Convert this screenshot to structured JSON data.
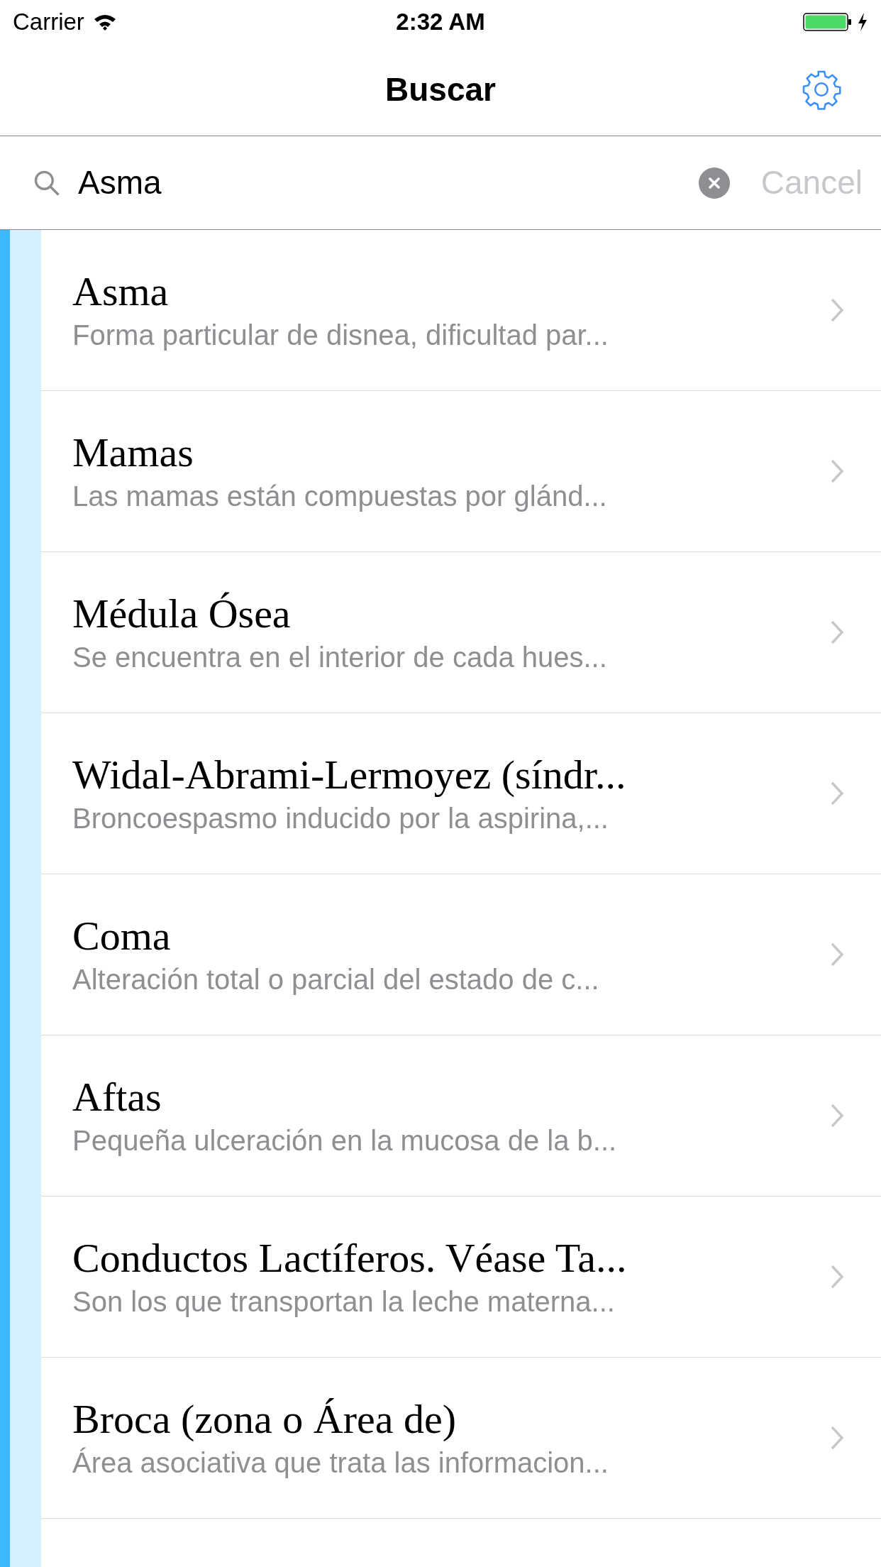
{
  "status_bar": {
    "carrier": "Carrier",
    "time": "2:32 AM"
  },
  "nav_bar": {
    "title": "Buscar"
  },
  "search": {
    "value": "Asma",
    "cancel": "Cancel"
  },
  "results": [
    {
      "title": "Asma",
      "subtitle": "Forma particular de disnea, dificultad par..."
    },
    {
      "title": "Mamas",
      "subtitle": "Las mamas están compuestas por glánd..."
    },
    {
      "title": "Médula Ósea",
      "subtitle": "Se encuentra en el interior de cada hues..."
    },
    {
      "title": "Widal-Abrami-Lermoyez (síndr...",
      "subtitle": "Broncoespasmo inducido por la aspirina,..."
    },
    {
      "title": "Coma",
      "subtitle": "Alteración total o parcial del estado de c..."
    },
    {
      "title": "Aftas",
      "subtitle": "Pequeña ulceración en la mucosa de la b..."
    },
    {
      "title": "Conductos Lactíferos. Véase Ta...",
      "subtitle": "Son los que transportan la leche materna..."
    },
    {
      "title": "Broca (zona o Área de)",
      "subtitle": "Área asociativa que trata las informacion..."
    }
  ]
}
